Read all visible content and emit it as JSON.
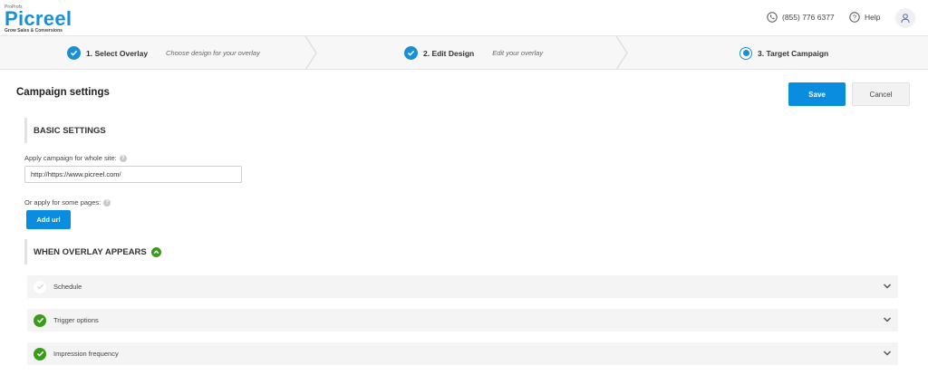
{
  "brand": {
    "pretitle": "ProProfs",
    "name": "Picreel",
    "tagline": "Grow Sales & Conversions",
    "color": "#1a8fd6"
  },
  "header": {
    "phone": "(855) 776 6377",
    "help": "Help",
    "icons": {
      "phone": "phone-icon",
      "help": "help-icon",
      "user": "user-icon"
    }
  },
  "steps": [
    {
      "title": "1. Select Overlay",
      "subtitle": "Choose design for your overlay",
      "state": "done"
    },
    {
      "title": "2. Edit Design",
      "subtitle": "Edit your overlay",
      "state": "done"
    },
    {
      "title": "3. Target Campaign",
      "subtitle": "",
      "state": "current"
    }
  ],
  "campaign": {
    "title": "Campaign settings",
    "save_label": "Save",
    "cancel_label": "Cancel"
  },
  "basic": {
    "heading": "BASIC SETTINGS",
    "whole_site_label": "Apply campaign for whole site:",
    "whole_site_value": "http://https://www.picreel.com/",
    "some_pages_label": "Or apply for some pages:",
    "add_url_label": "Add url"
  },
  "when": {
    "heading": "WHEN OVERLAY APPEARS",
    "items": [
      {
        "label": "Schedule",
        "enabled": false
      },
      {
        "label": "Trigger options",
        "enabled": true
      },
      {
        "label": "Impression frequency",
        "enabled": true
      }
    ]
  },
  "colors": {
    "primary": "#0b8ddf",
    "success": "#3a9c1a"
  }
}
